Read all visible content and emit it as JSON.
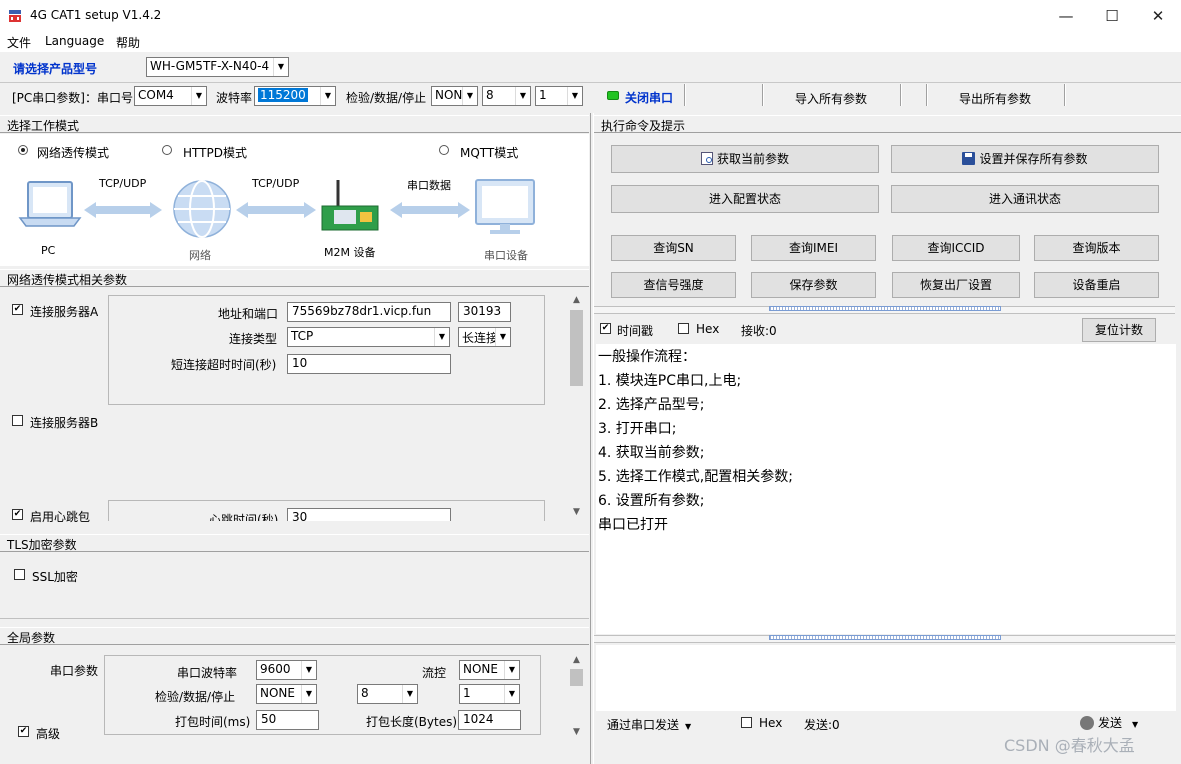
{
  "app": {
    "title": "4G CAT1 setup V1.4.2",
    "controls": {
      "minimize": "—",
      "maximize": "☐",
      "close": "✕"
    }
  },
  "menu": [
    "文件",
    "Language",
    "帮助"
  ],
  "product": {
    "label": "请选择产品型号",
    "value": "WH-GM5TF-X-N40-4"
  },
  "serial": {
    "label": "[PC串口参数]：串口号",
    "port": "COM4",
    "baud_label": "波特率",
    "baud": "115200",
    "check_label": "检验/数据/停止",
    "parity": "NONI",
    "databits": "8",
    "stopbits": "1",
    "status_color": "#22c322",
    "close_button": "关闭串口",
    "import_button": "导入所有参数",
    "export_button": "导出所有参数"
  },
  "work_mode": {
    "header": "选择工作模式",
    "modes": [
      {
        "label": "网络透传模式",
        "selected": true
      },
      {
        "label": "HTTPD模式",
        "selected": false
      },
      {
        "label": "MQTT模式",
        "selected": false
      }
    ],
    "diagram": {
      "pc": "PC",
      "net": "网络",
      "m2m": "M2M 设备",
      "dev": "串口设备",
      "link1": "TCP/UDP",
      "link2": "TCP/UDP",
      "link3": "串口数据"
    }
  },
  "net_params": {
    "header": "网络透传模式相关参数",
    "server_a": {
      "label": "连接服务器A",
      "checked": true,
      "addr_label": "地址和端口",
      "addr": "75569bz78dr1.vicp.fun",
      "port": "30193",
      "conn_type_label": "连接类型",
      "conn_type": "TCP",
      "conn_mode": "长连接",
      "timeout_label": "短连接超时时间(秒)",
      "timeout": "10"
    },
    "server_b": {
      "label": "连接服务器B",
      "checked": false
    },
    "heartbeat": {
      "label": "启用心跳包",
      "checked": true,
      "time_label": "心跳时间(秒)",
      "time": "30"
    }
  },
  "tls": {
    "header": "TLS加密参数",
    "ssl_label": "SSL加密",
    "ssl_checked": false
  },
  "global": {
    "header": "全局参数",
    "serial_label": "串口参数",
    "baud_label": "串口波特率",
    "baud": "9600",
    "flow_label": "流控",
    "flow": "NONE",
    "check_label": "检验/数据/停止",
    "parity": "NONE",
    "databits": "8",
    "stopbits": "1",
    "pack_time_label": "打包时间(ms)",
    "pack_time": "50",
    "pack_len_label": "打包长度(Bytes)",
    "pack_len": "1024",
    "advanced_label": "高级",
    "advanced_checked": true
  },
  "commands": {
    "header": "执行命令及提示",
    "get_params": "获取当前参数",
    "save_all": "设置并保存所有参数",
    "enter_config": "进入配置状态",
    "enter_comm": "进入通讯状态",
    "row1": [
      "查询SN",
      "查询IMEI",
      "查询ICCID",
      "查询版本"
    ],
    "row2": [
      "查信号强度",
      "保存参数",
      "恢复出厂设置",
      "设备重启"
    ]
  },
  "log": {
    "timestamp_label": "时间戳",
    "timestamp_checked": true,
    "hex_label": "Hex",
    "hex_checked": false,
    "recv_label": "接收:0",
    "reset_button": "复位计数",
    "lines": [
      "一般操作流程：",
      "1. 模块连PC串口,上电;",
      "2. 选择产品型号;",
      "3. 打开串口;",
      "4. 获取当前参数;",
      "5. 选择工作模式,配置相关参数;",
      "6. 设置所有参数;",
      "串口已打开"
    ]
  },
  "send": {
    "mode_label": "通过串口发送",
    "hex_label": "Hex",
    "hex_checked": false,
    "sent_label": "发送:0",
    "send_button": "发送"
  },
  "watermark": "CSDN @春秋大孟"
}
